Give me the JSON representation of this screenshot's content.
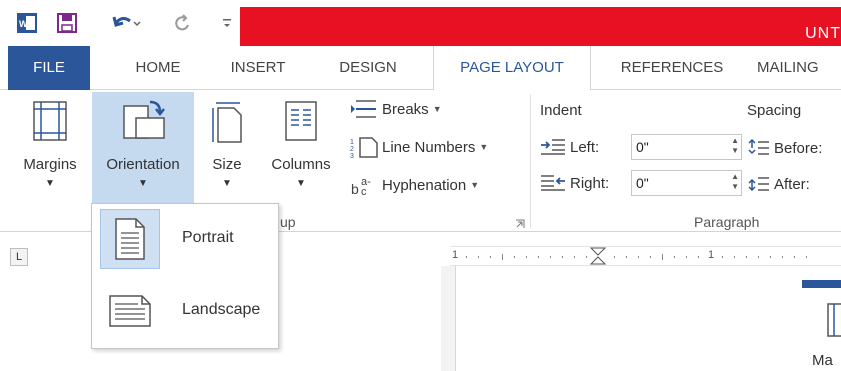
{
  "window": {
    "title_partial": "UNT"
  },
  "tabs": [
    {
      "label": "FILE"
    },
    {
      "label": "HOME"
    },
    {
      "label": "INSERT"
    },
    {
      "label": "DESIGN"
    },
    {
      "label": "PAGE LAYOUT"
    },
    {
      "label": "REFERENCES"
    },
    {
      "label": "MAILING"
    }
  ],
  "ribbon": {
    "margins_label": "Margins",
    "orientation_label": "Orientation",
    "size_label": "Size",
    "columns_label": "Columns",
    "breaks_label": "Breaks",
    "line_numbers_label": "Line Numbers",
    "hyphenation_label": "Hyphenation",
    "page_setup_group_partial": "up",
    "indent_label": "Indent",
    "spacing_label": "Spacing",
    "left_label": "Left:",
    "right_label": "Right:",
    "left_value": "0\"",
    "right_value": "0\"",
    "before_label": "Before:",
    "after_label": "After:",
    "paragraph_group": "Paragraph"
  },
  "orientation_menu": {
    "items": [
      {
        "label": "Portrait",
        "selected": true
      },
      {
        "label": "Landscape",
        "selected": false
      }
    ]
  },
  "tab_stop_glyph": "L",
  "ruler": {
    "marks": [
      "1",
      "1"
    ]
  },
  "page_partial": "Ma",
  "colors": {
    "file_tab": "#2b579a",
    "active_tab_text": "#2b579a",
    "title_red": "#e81123",
    "pressed_button": "#c5d9ef"
  }
}
